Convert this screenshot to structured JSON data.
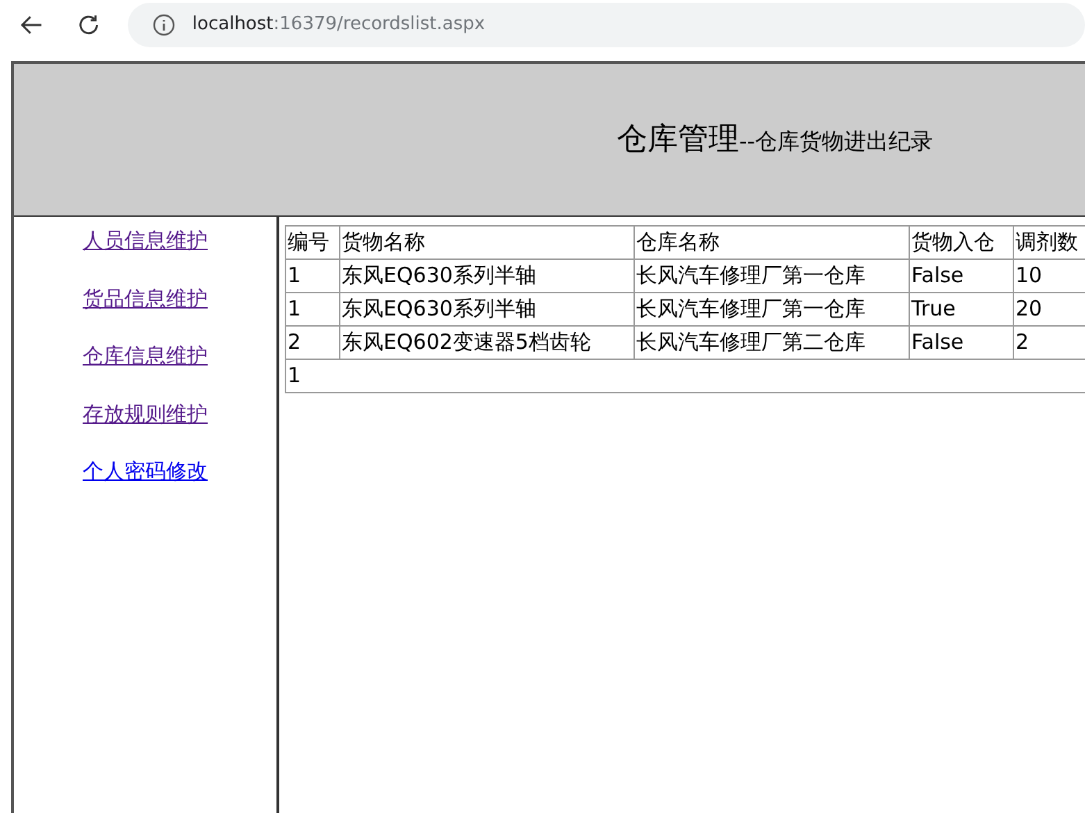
{
  "browser": {
    "url_host": "localhost",
    "url_rest": ":16379/recordslist.aspx"
  },
  "header": {
    "title": "仓库管理",
    "subtitle": "--仓库货物进出纪录"
  },
  "sidebar": {
    "items": [
      {
        "label": "人员信息维护",
        "visited": true
      },
      {
        "label": "货品信息维护",
        "visited": true
      },
      {
        "label": "仓库信息维护",
        "visited": true
      },
      {
        "label": "存放规则维护",
        "visited": true
      },
      {
        "label": "个人密码修改",
        "visited": false
      }
    ]
  },
  "table": {
    "columns": [
      "编号",
      "货物名称",
      "仓库名称",
      "货物入仓",
      "调剂数"
    ],
    "rows": [
      [
        "1",
        "东风EQ630系列半轴",
        "长风汽车修理厂第一仓库",
        "False",
        "10"
      ],
      [
        "1",
        "东风EQ630系列半轴",
        "长风汽车修理厂第一仓库",
        "True",
        "20"
      ],
      [
        "2",
        "东风EQ602变速器5档齿轮",
        "长风汽车修理厂第二仓库",
        "False",
        "2"
      ]
    ],
    "pager": [
      "1"
    ]
  }
}
